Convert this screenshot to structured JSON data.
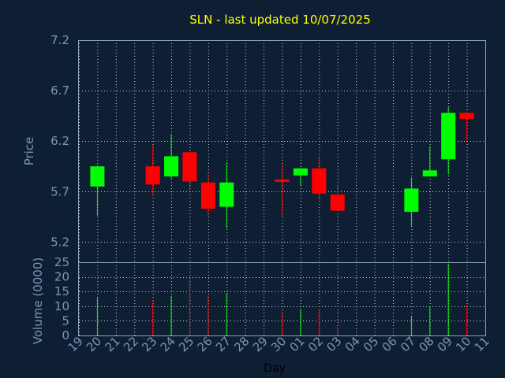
{
  "chart_data": {
    "type": "candlestick",
    "title": "SLN - last updated 10/07/2025",
    "xlabel": "Day",
    "price_panel": {
      "ylabel": "Price",
      "ylim": [
        5.0,
        7.2
      ],
      "yticks": [
        "7.2",
        "6.7",
        "6.2",
        "5.7",
        "5.2"
      ],
      "ytick_values": [
        7.2,
        6.7,
        6.2,
        5.7,
        5.2
      ],
      "grid": true
    },
    "volume_panel": {
      "ylabel": "Volume (0000)",
      "ylim": [
        0,
        25
      ],
      "yticks": [
        "25",
        "20",
        "15",
        "10",
        "5",
        "0"
      ],
      "ytick_values": [
        25,
        20,
        15,
        10,
        5,
        0
      ],
      "grid": true
    },
    "xticks": [
      "19",
      "20",
      "21",
      "22",
      "23",
      "24",
      "25",
      "26",
      "27",
      "28",
      "29",
      "30",
      "01",
      "02",
      "03",
      "04",
      "05",
      "06",
      "07",
      "08",
      "09",
      "10",
      "11"
    ],
    "colors": {
      "up": "#00ff00",
      "down": "#ff0000"
    },
    "candles": [
      {
        "index": 1,
        "open": 5.75,
        "close": 5.95,
        "high": 5.96,
        "low": 5.46,
        "volume": 13
      },
      {
        "index": 4,
        "open": 5.95,
        "close": 5.77,
        "high": 6.16,
        "low": 5.67,
        "volume": 12
      },
      {
        "index": 5,
        "open": 5.85,
        "close": 6.05,
        "high": 6.27,
        "low": 5.83,
        "volume": 13.5
      },
      {
        "index": 6,
        "open": 6.09,
        "close": 5.8,
        "high": 6.09,
        "low": 5.71,
        "volume": 19
      },
      {
        "index": 7,
        "open": 5.79,
        "close": 5.53,
        "high": 5.88,
        "low": 5.46,
        "volume": 13.5
      },
      {
        "index": 8,
        "open": 5.55,
        "close": 5.79,
        "high": 5.99,
        "low": 5.34,
        "volume": 14.5
      },
      {
        "index": 11,
        "open": 5.82,
        "close": 5.8,
        "high": 5.97,
        "low": 5.46,
        "volume": 8
      },
      {
        "index": 12,
        "open": 5.86,
        "close": 5.93,
        "high": 5.93,
        "low": 5.76,
        "volume": 9
      },
      {
        "index": 13,
        "open": 5.93,
        "close": 5.68,
        "high": 6.04,
        "low": 5.62,
        "volume": 9
      },
      {
        "index": 14,
        "open": 5.67,
        "close": 5.51,
        "high": 5.77,
        "low": 5.51,
        "volume": 3
      },
      {
        "index": 18,
        "open": 5.5,
        "close": 5.73,
        "high": 5.84,
        "low": 5.35,
        "volume": 6.5
      },
      {
        "index": 19,
        "open": 5.85,
        "close": 5.91,
        "high": 6.15,
        "low": 5.85,
        "volume": 10
      },
      {
        "index": 20,
        "open": 6.02,
        "close": 6.48,
        "high": 6.54,
        "low": 5.87,
        "volume": 24.5
      },
      {
        "index": 21,
        "open": 6.48,
        "close": 6.42,
        "high": 6.48,
        "low": 6.19,
        "volume": 10.5
      }
    ]
  }
}
